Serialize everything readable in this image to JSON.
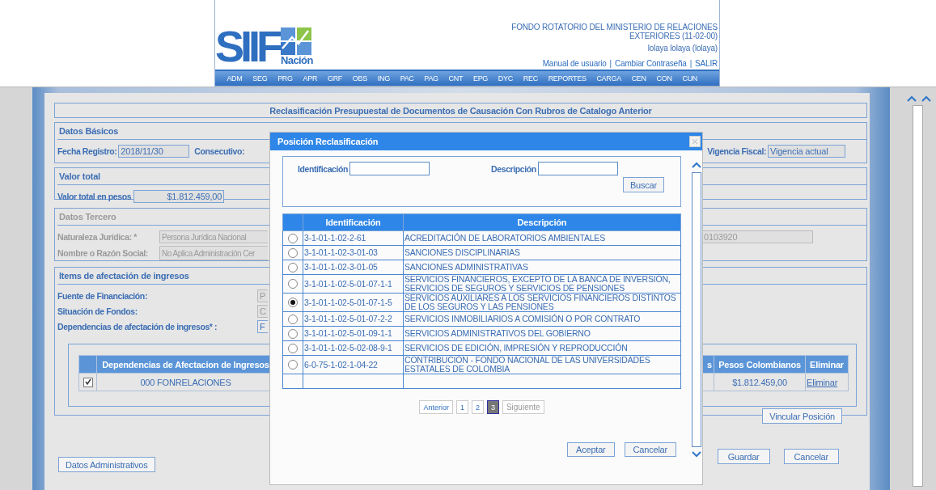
{
  "header": {
    "logo_text": "SIIF",
    "logo_subtext": "Nación",
    "entity_lines": [
      "FONDO ROTATORIO DEL MINISTERIO DE RELACIONES",
      "EXTERIORES (11-02-00)"
    ],
    "user": "lolaya lolaya (lolaya)",
    "links": [
      {
        "kind": "link",
        "label": "Manual de usuario"
      },
      {
        "kind": "separator",
        "label": "|"
      },
      {
        "kind": "link",
        "label": "Cambiar Contraseña"
      },
      {
        "kind": "separator",
        "label": "|"
      },
      {
        "kind": "link",
        "label": "SALIR"
      }
    ],
    "menu": [
      "ADM",
      "SEG",
      "PRG",
      "APR",
      "GRF",
      "OBS",
      "ING",
      "PAC",
      "PAG",
      "CNT",
      "EPG",
      "DYC",
      "REC",
      "REPORTES",
      "CARGA",
      "CEN",
      "CON",
      "CUN"
    ]
  },
  "form": {
    "title": "Reclasificación Presupuestal de Documentos de Causación Con Rubros de Catalogo Anterior",
    "basic": {
      "heading": "Datos Básicos",
      "fecha_label": "Fecha Registro:",
      "fecha_value": "2018/11/30",
      "consecutivo_label": "Consecutivo:",
      "vigencia_label": "Vigencia Fiscal:",
      "vigencia_value": "Vigencia actual"
    },
    "total": {
      "heading": "Valor total",
      "label": "Valor total en pesos",
      "value": "$1.812.459,00"
    },
    "tercero": {
      "heading": "Datos Tercero",
      "disabled": true,
      "naturaleza_label": "Naturaleza Jurídica: *",
      "naturaleza_value": "Persona Jurídica Nacional",
      "documento_value": "0103920",
      "nombre_label": "Nombre o Razón Social:",
      "nombre_value": "No Aplica Administración Cer"
    },
    "items": {
      "heading": "Items de afectación de ingresos",
      "fields": [
        {
          "label": "Fuente de Financiación:",
          "value": "P",
          "disabled": true
        },
        {
          "label": "Situación de Fondos:",
          "value": "C",
          "disabled": true
        },
        {
          "label": "Dependencias de afectación de ingresos* :",
          "value": "F",
          "disabled": false
        }
      ],
      "table": {
        "columns": [
          "Dependencias de Afectacion de Ingresos",
          "s",
          "Pesos Colombianos",
          "Eliminar"
        ],
        "rows": [
          {
            "checked": true,
            "dependencia": "000 FONRELACIONES",
            "pesos": "$1.812.459,00",
            "eliminar": "Eliminar"
          }
        ]
      },
      "link_button": "Vincular Posición"
    },
    "admin_button": "Datos Administrativos",
    "buttons": [
      "Guardar",
      "Cancelar"
    ]
  },
  "modal": {
    "title": "Posición Reclasificación",
    "search_fields": [
      "Identificación",
      "Descripción"
    ],
    "search_button": "Buscar",
    "columns": [
      "Identificación",
      "Descripción"
    ],
    "rows": [
      {
        "selected": false,
        "id": "3-1-01-1-02-2-61",
        "description": "ACREDITACIÓN DE LABORATORIOS AMBIENTALES"
      },
      {
        "selected": false,
        "id": "3-1-01-1-02-3-01-03",
        "description": "SANCIONES DISCIPLINARIAS"
      },
      {
        "selected": false,
        "id": "3-1-01-1-02-3-01-05",
        "description": "SANCIONES ADMINISTRATIVAS"
      },
      {
        "selected": false,
        "id": "3-1-01-1-02-5-01-07-1-1",
        "description": "SERVICIOS FINANCIEROS, EXCEPTO DE LA BANCA DE INVERSIÓN, SERVICIOS DE SEGUROS Y SERVICIOS DE PENSIONES"
      },
      {
        "selected": true,
        "id": "3-1-01-1-02-5-01-07-1-5",
        "description": "SERVICIOS AUXILIARES A LOS SERVICIOS FINANCIEROS DISTINTOS DE LOS SEGUROS Y LAS PENSIONES"
      },
      {
        "selected": false,
        "id": "3-1-01-1-02-5-01-07-2-2",
        "description": "SERVICIOS INMOBILIARIOS A COMISIÓN O POR CONTRATO"
      },
      {
        "selected": false,
        "id": "3-1-01-1-02-5-01-09-1-1",
        "description": "SERVICIOS ADMINISTRATIVOS DEL GOBIERNO"
      },
      {
        "selected": false,
        "id": "3-1-01-1-02-5-02-08-9-1",
        "description": "SERVICIOS DE EDICIÓN, IMPRESIÓN Y REPRODUCCIÓN"
      },
      {
        "selected": false,
        "id": "6-0-75-1-02-1-04-22",
        "description": "CONTRIBUCIÓN - FONDO NACIONAL DE LAS UNIVERSIDADES ESTATALES DE COLOMBIA"
      }
    ],
    "pagination": [
      {
        "label": "Anterior",
        "kind": "nav",
        "selected": false,
        "disabled": false
      },
      {
        "label": "1",
        "kind": "page",
        "selected": false,
        "disabled": false
      },
      {
        "label": "2",
        "kind": "page",
        "selected": false,
        "disabled": false
      },
      {
        "label": "3",
        "kind": "page",
        "selected": true,
        "disabled": false
      },
      {
        "label": "Siguiente",
        "kind": "nav",
        "selected": false,
        "disabled": true
      }
    ],
    "buttons": [
      "Aceptar",
      "Cancelar"
    ]
  }
}
